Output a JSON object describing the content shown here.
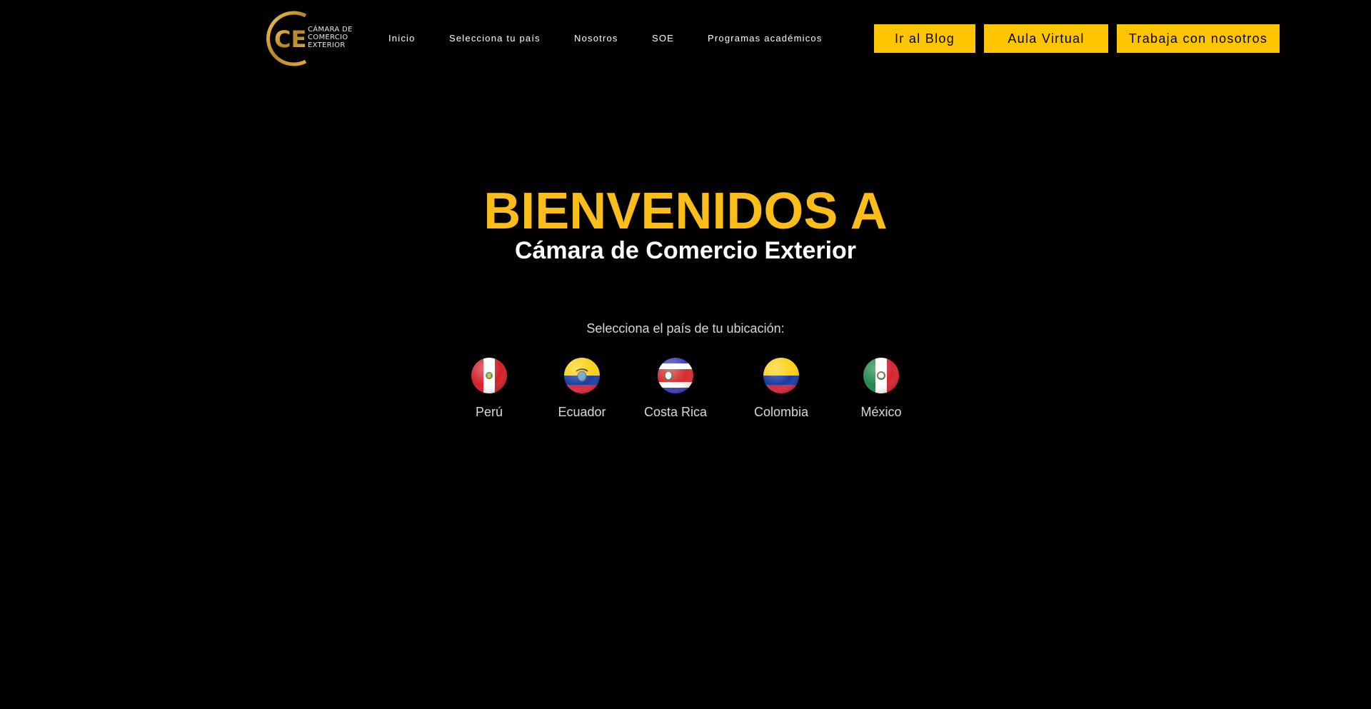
{
  "header": {
    "logo": {
      "monogram": "CE",
      "text_lines": [
        "CÁMARA DE",
        "COMERCIO",
        "EXTERIOR"
      ]
    },
    "nav": [
      {
        "label": "Inicio"
      },
      {
        "label": "Selecciona tu país"
      },
      {
        "label": "Nosotros"
      },
      {
        "label": "SOE"
      },
      {
        "label": "Programas académicos"
      }
    ],
    "buttons": [
      {
        "label": "Ir al Blog"
      },
      {
        "label": "Aula Virtual"
      },
      {
        "label": "Trabaja con nosotros"
      }
    ]
  },
  "hero": {
    "title": "BIENVENIDOS A",
    "subtitle": "Cámara de Comercio Exterior"
  },
  "country_selector": {
    "label": "Selecciona el país de tu ubicación:",
    "countries": [
      {
        "name": "Perú",
        "flag_icon": "peru-flag-icon"
      },
      {
        "name": "Ecuador",
        "flag_icon": "ecuador-flag-icon"
      },
      {
        "name": "Costa Rica",
        "flag_icon": "costa-rica-flag-icon"
      },
      {
        "name": "Colombia",
        "flag_icon": "colombia-flag-icon"
      },
      {
        "name": "México",
        "flag_icon": "mexico-flag-icon"
      }
    ]
  },
  "colors": {
    "background": "#000000",
    "accent": "#ffc600",
    "title": "#fbbd19",
    "text": "#ffffff",
    "muted_text": "#d8d8d8"
  }
}
